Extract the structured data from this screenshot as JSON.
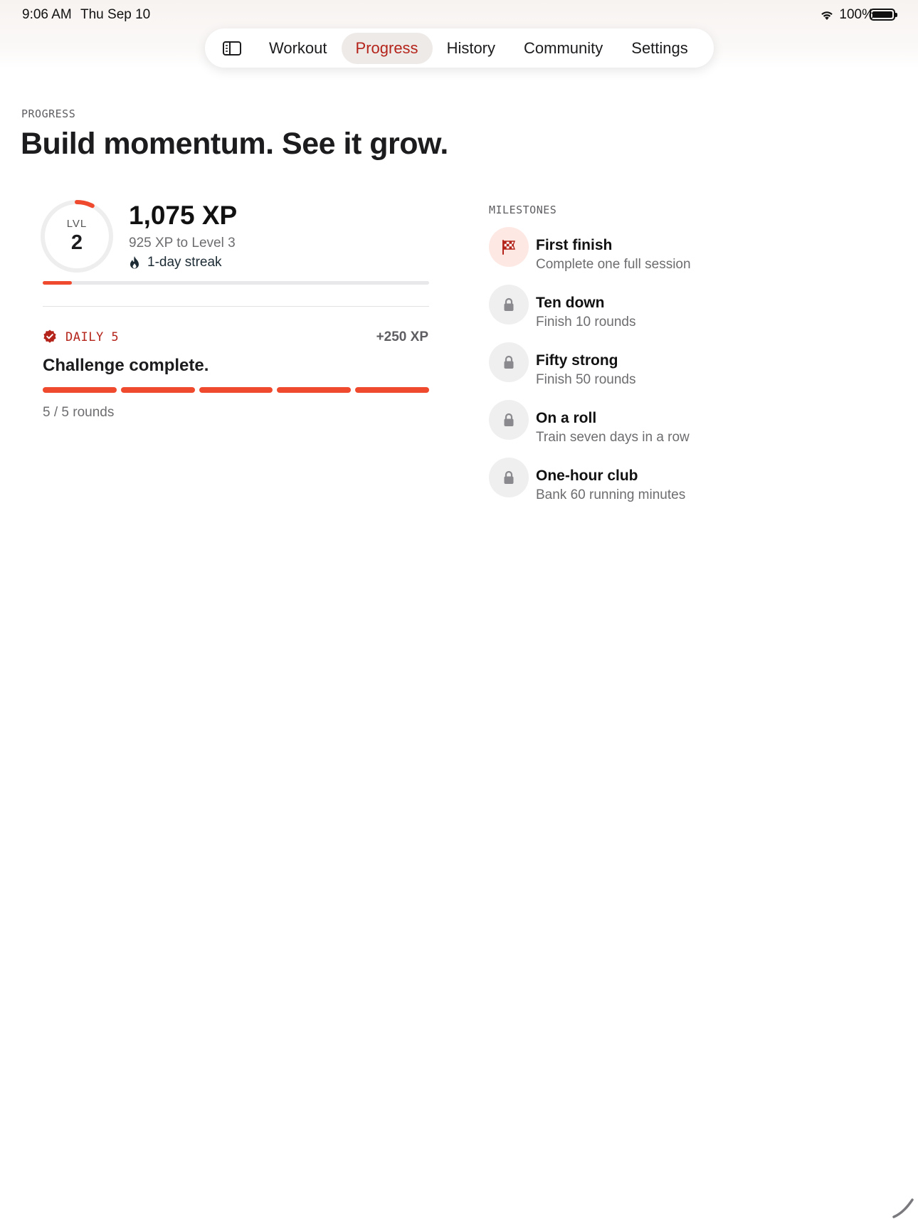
{
  "status_bar": {
    "time": "9:06 AM",
    "date": "Thu Sep 10",
    "battery": "100%"
  },
  "tabs": [
    {
      "label": "Workout",
      "active": false
    },
    {
      "label": "Progress",
      "active": true
    },
    {
      "label": "History",
      "active": false
    },
    {
      "label": "Community",
      "active": false
    },
    {
      "label": "Settings",
      "active": false
    }
  ],
  "header": {
    "eyebrow": "PROGRESS",
    "title": "Build momentum. See it grow."
  },
  "level": {
    "label": "LVL",
    "number": "2",
    "ring_progress": 0.075,
    "xp_total": "1,075 XP",
    "xp_to_next": "925 XP to Level 3",
    "streak": "1-day streak",
    "bar_progress": 0.075
  },
  "daily": {
    "label": "DAILY 5",
    "reward": "+250 XP",
    "title": "Challenge complete.",
    "completed": 5,
    "total": 5,
    "count_text": "5 / 5 rounds"
  },
  "milestones": {
    "label": "MILESTONES",
    "items": [
      {
        "title": "First finish",
        "description": "Complete one full session",
        "earned": true,
        "icon": "checkered-flag-icon"
      },
      {
        "title": "Ten down",
        "description": "Finish 10 rounds",
        "earned": false,
        "icon": "lock-icon"
      },
      {
        "title": "Fifty strong",
        "description": "Finish 50 rounds",
        "earned": false,
        "icon": "lock-icon"
      },
      {
        "title": "On a roll",
        "description": "Train seven days in a row",
        "earned": false,
        "icon": "lock-icon"
      },
      {
        "title": "One-hour club",
        "description": "Bank 60 running minutes",
        "earned": false,
        "icon": "lock-icon"
      }
    ]
  },
  "colors": {
    "accent": "#f04a2e",
    "accent_dark": "#b4241a",
    "track": "#e8e8ea"
  }
}
